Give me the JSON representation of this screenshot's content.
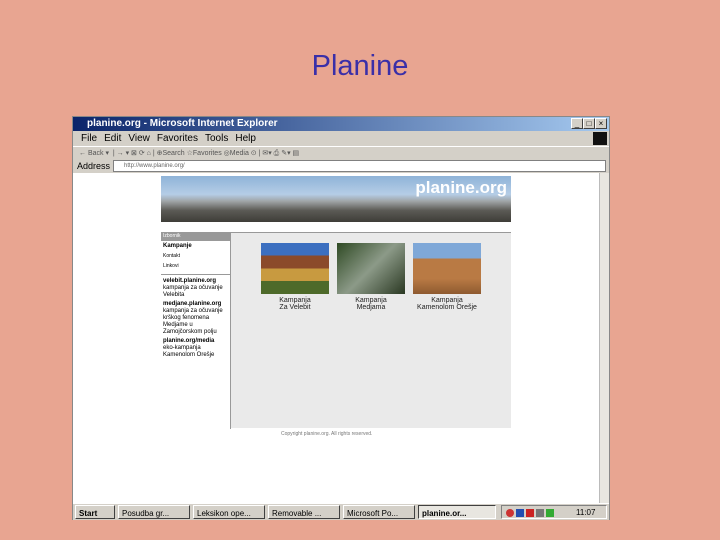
{
  "slide": {
    "title": "Planine"
  },
  "browser": {
    "title": "planine.org - Microsoft Internet Explorer",
    "menu": [
      "File",
      "Edit",
      "View",
      "Favorites",
      "Tools",
      "Help"
    ],
    "toolbar": {
      "back": "Back",
      "search": "Search",
      "favorites": "Favorites",
      "media": "Media"
    },
    "address_label": "Address",
    "address_value": "http://www.planine.org/"
  },
  "page": {
    "logo": "planine.org",
    "nav_header": "Izbornik",
    "nav_items": [
      "Kampanje",
      "Kontakt",
      "Linkovi"
    ],
    "sections": [
      {
        "title": "velebit.planine.org",
        "lines": [
          "kampanja za očuvanje",
          "Velebita"
        ]
      },
      {
        "title": "medjane.planine.org",
        "lines": [
          "kampanja za očuvanje",
          "krškog fenomena",
          "Medjame u",
          "Zamojčorskom polju"
        ]
      },
      {
        "title": "planine.org/media",
        "lines": [
          "eko-kampanja",
          "Kamenolom Orešje"
        ]
      }
    ],
    "campaigns": [
      {
        "line1": "Kampanja",
        "line2": "Za Velebit",
        "color": "#8A6A2A"
      },
      {
        "line1": "Kampanja",
        "line2": "Medjama",
        "color": "#3E4B32"
      },
      {
        "line1": "Kampanja",
        "line2": "Kamenolom Orešje",
        "color": "#A0683A"
      }
    ],
    "footer": "Copyright planine.org. All rights reserved."
  },
  "taskbar": {
    "start": "Start",
    "tasks": [
      "Posudba gr...",
      "Leksikon ope...",
      "Removable ...",
      "Microsoft Po...",
      "planine.or..."
    ],
    "clock": "11:07"
  }
}
